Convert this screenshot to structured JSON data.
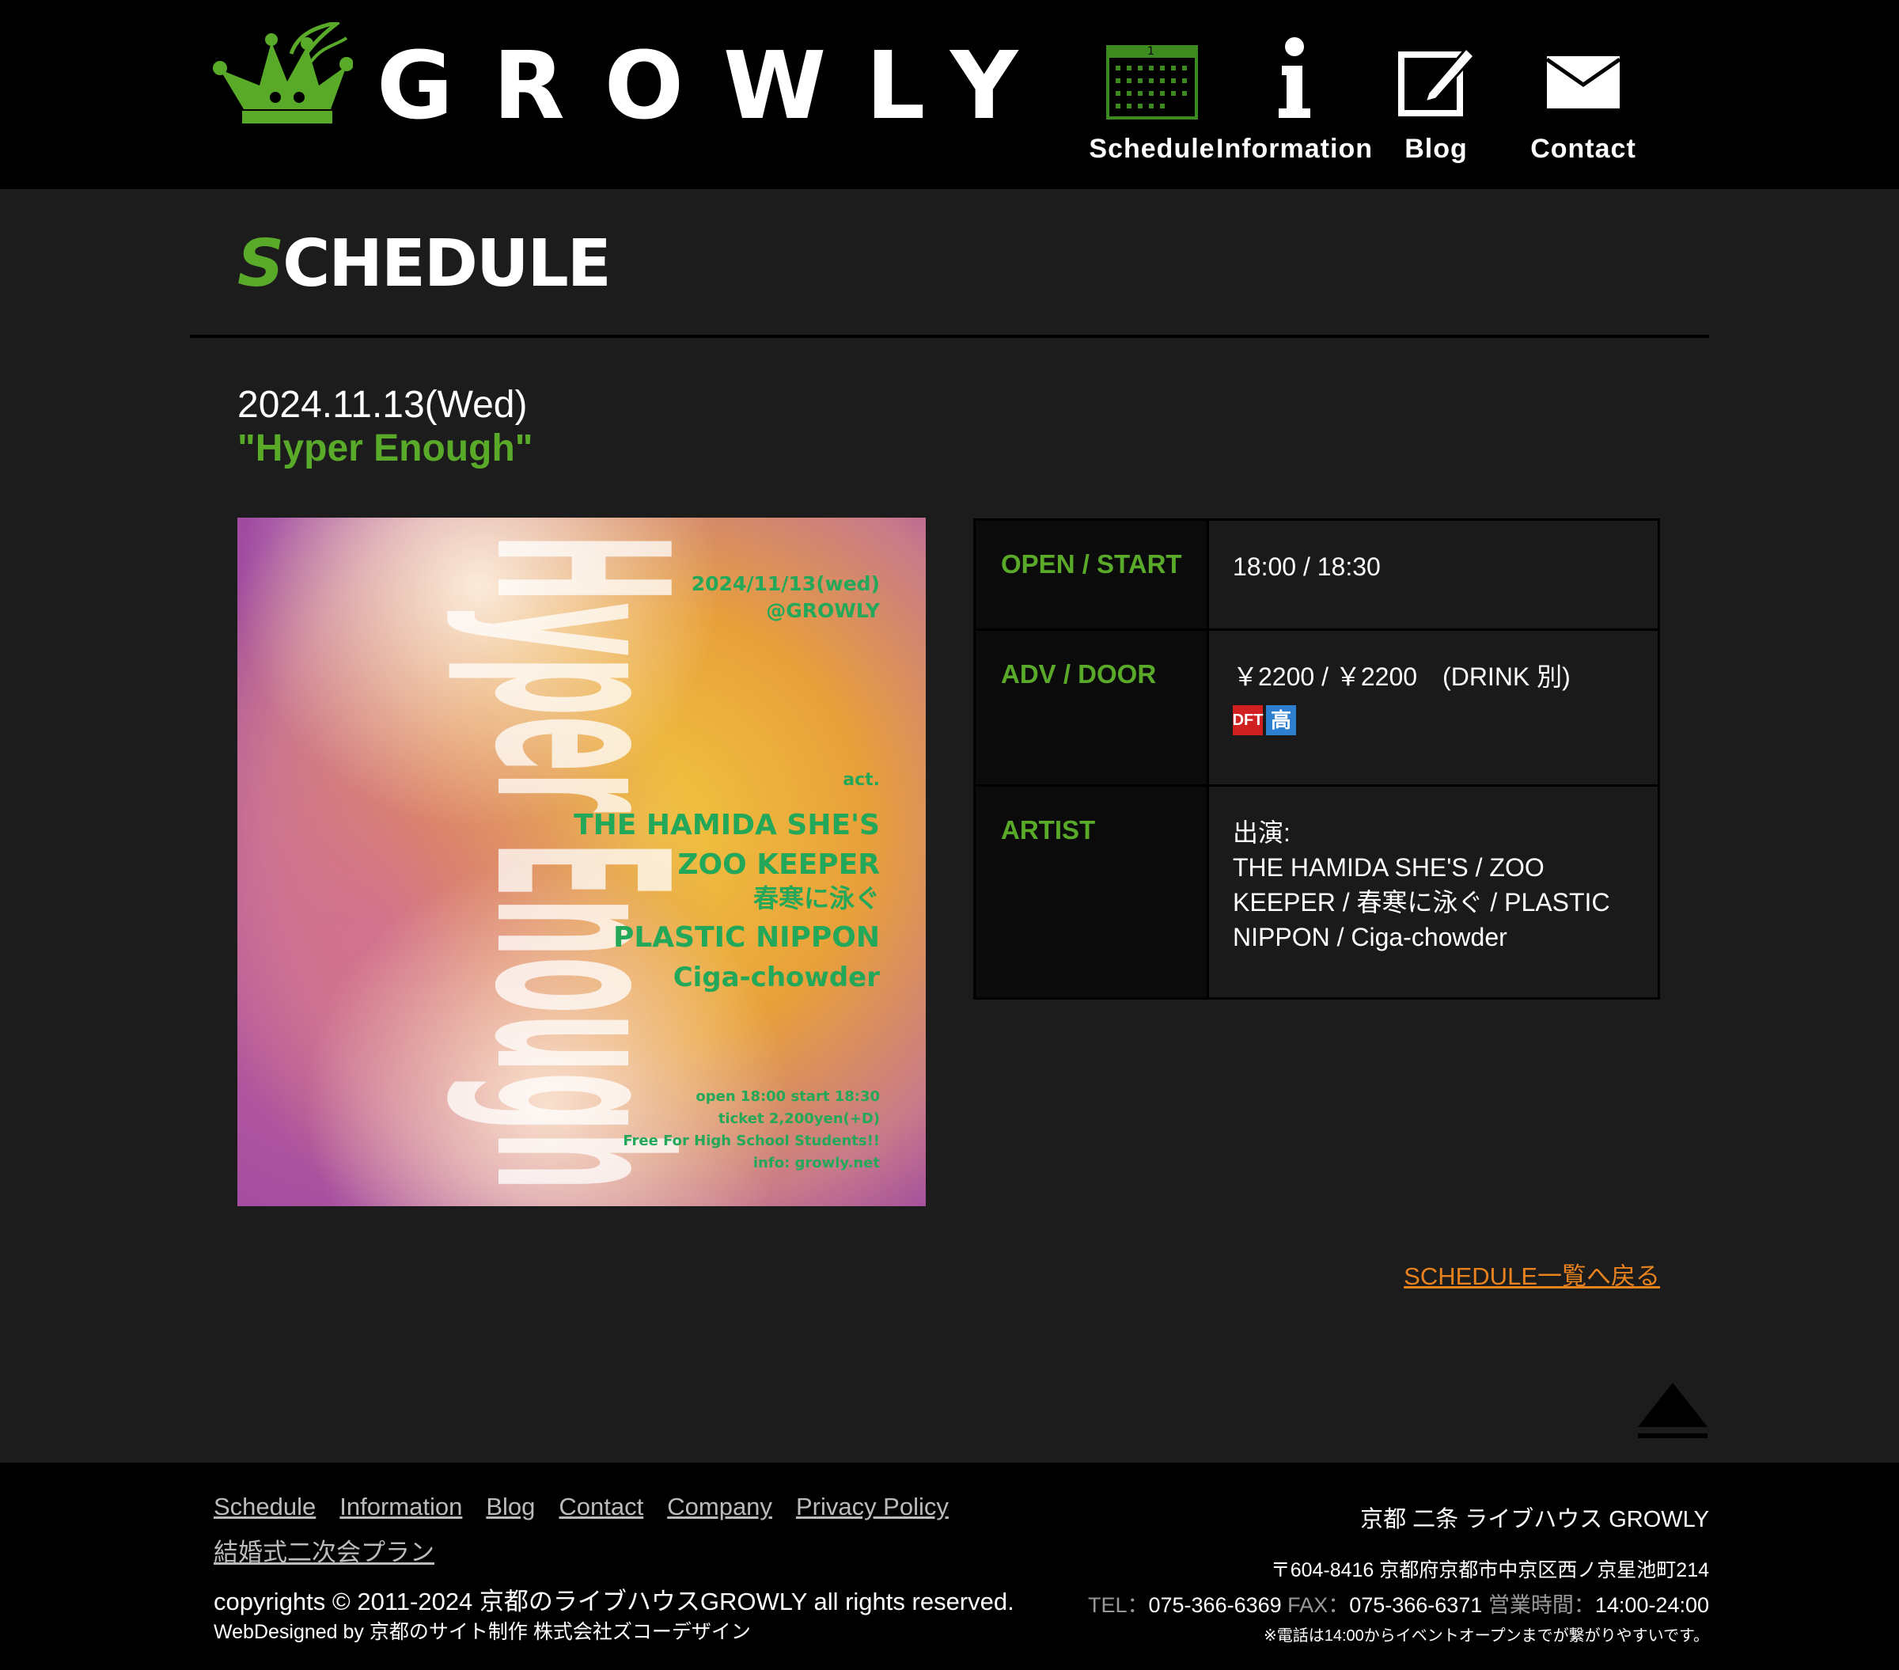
{
  "header": {
    "logo_text": "GROWLY",
    "nav": [
      {
        "label": "Schedule"
      },
      {
        "label": "Information"
      },
      {
        "label": "Blog"
      },
      {
        "label": "Contact"
      }
    ]
  },
  "section": {
    "title_first": "S",
    "title_rest": "CHEDULE"
  },
  "event": {
    "date": "2024.11.13(Wed)",
    "title": "\"Hyper Enough\"",
    "flyer": {
      "vertical_title": "Hyper Enough",
      "date": "2024/11/13(wed)",
      "venue": "@GROWLY",
      "act_label": "act.",
      "acts": [
        "THE HAMIDA SHE'S",
        "ZOO KEEPER",
        "春寒に泳ぐ",
        "PLASTIC NIPPON",
        "Ciga-chowder"
      ],
      "bottom": [
        "open 18:00 start 18:30",
        "ticket 2,200yen(+D)",
        "Free For High School Students!!",
        "info: growly.net"
      ]
    },
    "info": {
      "open_label": "OPEN / START",
      "open_value": "18:00 / 18:30",
      "price_label": "ADV / DOOR",
      "price_value": "￥2200 / ￥2200　(DRINK 別)",
      "badge_dft": "DFT",
      "badge_high": "高",
      "artist_label": "ARTIST",
      "artist_prefix": "出演:",
      "artist_value": "THE HAMIDA SHE'S / ZOO KEEPER / 春寒に泳ぐ / PLASTIC NIPPON / Ciga-chowder"
    },
    "back_link": "SCHEDULE一覧へ戻る"
  },
  "footer": {
    "links": [
      "Schedule",
      "Information",
      "Blog",
      "Contact",
      "Company",
      "Privacy Policy",
      "結婚式二次会プラン"
    ],
    "copyright": "copyrights © 2011-2024 京都のライブハウスGROWLY all rights reserved.",
    "webdesign": "WebDesigned by 京都のサイト制作 株式会社ズコーデザイン",
    "venue_name": "京都 二条 ライブハウス GROWLY",
    "address": "〒604-8416 京都府京都市中京区西ノ京星池町214",
    "tel_label": "TEL：",
    "tel": "075-366-6369",
    "fax_label": "FAX：",
    "fax": "075-366-6371",
    "hours_label": "営業時間：",
    "hours": "14:00-24:00",
    "note": "※電話は14:00からイベントオープンまでが繋がりやすいです。"
  },
  "colors": {
    "accent_green": "#5aaa2a",
    "link_orange": "#e8821e",
    "background": "#1c1c1c"
  }
}
